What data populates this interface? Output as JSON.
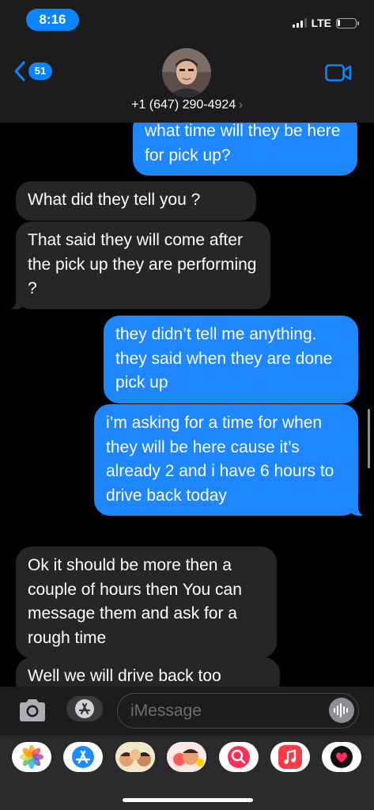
{
  "status": {
    "time": "8:16",
    "network": "LTE",
    "signal_bars_filled": 3,
    "battery_level": 0.15
  },
  "header": {
    "back_badge": "51",
    "contact_name": "+1 (647) 290-4924",
    "contact_chevron": "›",
    "back_icon": "chevron-left-icon",
    "video_icon": "video-camera-icon"
  },
  "messages": [
    {
      "direction": "outgoing",
      "text": "what time will they be here for pick up?"
    },
    {
      "direction": "incoming",
      "text": "What did they tell you ?"
    },
    {
      "direction": "incoming",
      "text": "That said they will come after the pick up they are performing ?"
    },
    {
      "direction": "outgoing",
      "text": "they didn’t tell me anything. they said when they are done pick up"
    },
    {
      "direction": "outgoing",
      "text": "i’m asking for a time for when they will be here cause it’s already 2 and i have 6 hours to drive back today"
    },
    {
      "direction": "incoming",
      "text": "Ok it should be more then a couple of hours then You can message them and ask for a rough time"
    },
    {
      "direction": "incoming",
      "text": "Well we will drive back too"
    }
  ],
  "input": {
    "placeholder": "iMessage",
    "value": ""
  },
  "colors": {
    "outgoing_bubble": "#1e86ff",
    "incoming_bubble": "#262629",
    "accent": "#0a84ff"
  },
  "drawer_apps": [
    {
      "name": "photos-icon"
    },
    {
      "name": "app-store-icon"
    },
    {
      "name": "memoji-stickers-icon"
    },
    {
      "name": "animoji-icon"
    },
    {
      "name": "image-search-icon"
    },
    {
      "name": "music-icon"
    },
    {
      "name": "digital-touch-icon"
    }
  ]
}
